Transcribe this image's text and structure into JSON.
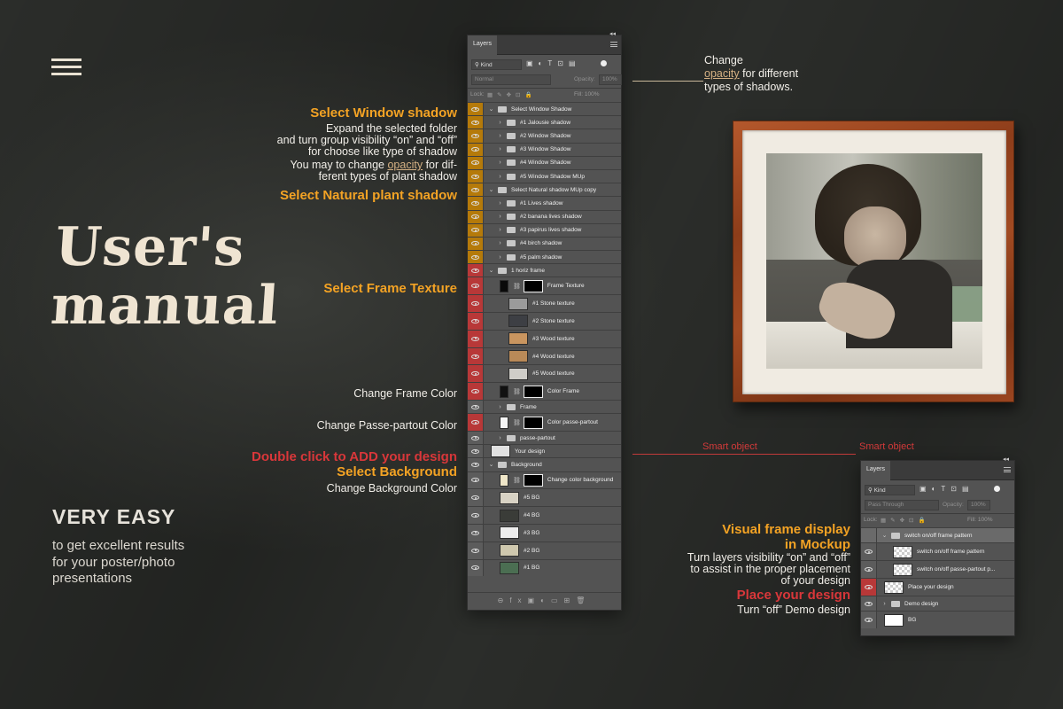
{
  "heading": {
    "title_line1": "User's",
    "title_line2": "manual"
  },
  "easy": {
    "heading": "VERY EASY",
    "line1": "to get excellent results",
    "line2": "for your poster/photo",
    "line3": "presentations"
  },
  "top_note": {
    "line1": "Change",
    "line2_highlight": "opacity",
    "line2_rest": " for different",
    "line3": "types of shadows."
  },
  "smart_object": {
    "label_left": "Smart object",
    "label_right": "Smart object"
  },
  "annotations": {
    "select_window_shadow": "Select Window shadow",
    "expand_line1": "Expand the selected folder",
    "expand_line2": "and turn group visibility “on” and “off”",
    "expand_line3": "for choose like type of shadow",
    "change_op_pre": "You may to change ",
    "change_op_link": "opacity",
    "change_op_post": " for dif-",
    "change_op_line2": "ferent types of plant shadow",
    "select_natural": "Select Natural plant shadow",
    "select_frame_texture": "Select Frame Texture",
    "change_frame_color": "Change Frame Color",
    "change_passe_color": "Change Passe-partout Color",
    "double_click": "Double click to ADD your design",
    "select_background": "Select Background",
    "change_background": "Change Background Color"
  },
  "right_annotations": {
    "visual_line1": "Visual frame display",
    "visual_line2": "in Mockup",
    "turn_line1": "Turn layers visibility “on” and “off”",
    "turn_line2": "to assist in the proper placement",
    "turn_line3": "of your design",
    "place_design": "Place your design",
    "turn_off_demo": "Turn “off” Demo design"
  },
  "panel_main": {
    "tab": "Layers",
    "kind": "⚲ Kind",
    "blend": "Normal",
    "opacity_label": "Opacity:",
    "opacity_value": "100%",
    "lock_label": "Lock:",
    "fill_label": "Fill:",
    "fill_value": "100%",
    "layers": [
      {
        "name": "Select Window Shadow",
        "kind": "group",
        "indent": 0,
        "vis": "or",
        "open": true
      },
      {
        "name": "#1 Jalousie shadow",
        "kind": "group",
        "indent": 1,
        "vis": "or"
      },
      {
        "name": "#2 Window Shadow",
        "kind": "group",
        "indent": 1,
        "vis": "or"
      },
      {
        "name": "#3 Window Shadow",
        "kind": "group",
        "indent": 1,
        "vis": "or"
      },
      {
        "name": "#4 Window Shadow",
        "kind": "group",
        "indent": 1,
        "vis": "or"
      },
      {
        "name": "#5 Window Shadow MUp",
        "kind": "group",
        "indent": 1,
        "vis": "or"
      },
      {
        "name": "Select Natural shadow MUp copy",
        "kind": "group",
        "indent": 0,
        "vis": "or",
        "open": true
      },
      {
        "name": "#1 Lives shadow",
        "kind": "group",
        "indent": 1,
        "vis": "or"
      },
      {
        "name": "#2 banana lives shadow",
        "kind": "group",
        "indent": 1,
        "vis": "or"
      },
      {
        "name": "#3 papirus lives shadow",
        "kind": "group",
        "indent": 1,
        "vis": "or"
      },
      {
        "name": "#4 birch shadow",
        "kind": "group",
        "indent": 1,
        "vis": "or"
      },
      {
        "name": "#5 palm shadow",
        "kind": "group",
        "indent": 1,
        "vis": "or"
      },
      {
        "name": "1 horiz frame",
        "kind": "group",
        "indent": 0,
        "vis": "red",
        "open": true
      },
      {
        "name": "Frame Texture",
        "kind": "smart",
        "indent": 1,
        "vis": "red",
        "thumb": "#0a0a0a",
        "tall": true
      },
      {
        "name": "#1 Stone texture",
        "kind": "image",
        "indent": 2,
        "vis": "red",
        "thumb": "#9a9a9a",
        "tall": true
      },
      {
        "name": "#2 Stone texture",
        "kind": "image",
        "indent": 2,
        "vis": "red",
        "thumb": "#3d3f44",
        "tall": true
      },
      {
        "name": "#3 Wood texture",
        "kind": "image",
        "indent": 2,
        "vis": "red",
        "thumb": "#c9955f",
        "tall": true
      },
      {
        "name": "#4 Wood texture",
        "kind": "image",
        "indent": 2,
        "vis": "red",
        "thumb": "#b98a58",
        "tall": true
      },
      {
        "name": "#5 Wood texture",
        "kind": "image",
        "indent": 2,
        "vis": "red",
        "thumb": "#cfcdc8",
        "tall": true
      },
      {
        "name": "Color Frame",
        "kind": "fill",
        "indent": 1,
        "vis": "red",
        "thumb": "#111111",
        "tall": true
      },
      {
        "name": "Frame",
        "kind": "group",
        "indent": 1,
        "vis": "grey"
      },
      {
        "name": "Color passe-partout",
        "kind": "fill",
        "indent": 1,
        "vis": "red",
        "thumb": "#f5f5f5",
        "tall": true
      },
      {
        "name": "passe-partout",
        "kind": "group",
        "indent": 1,
        "vis": "grey"
      },
      {
        "name": "Your design",
        "kind": "image",
        "indent": 0,
        "vis": "grey",
        "thumb": "#e0e0e0"
      },
      {
        "name": "Background",
        "kind": "group",
        "indent": 0,
        "vis": "grey",
        "open": true
      },
      {
        "name": "Change color background",
        "kind": "fill",
        "indent": 1,
        "vis": "grey",
        "thumb": "#efe6c8",
        "tall": true
      },
      {
        "name": "#5 BG",
        "kind": "image",
        "indent": 1,
        "vis": "grey",
        "thumb": "#d8d2c4",
        "tall": true
      },
      {
        "name": "#4 BG",
        "kind": "image",
        "indent": 1,
        "vis": "grey",
        "thumb": "#3a3c38",
        "tall": true
      },
      {
        "name": "#3 BG",
        "kind": "image",
        "indent": 1,
        "vis": "grey",
        "thumb": "#ededed",
        "tall": true
      },
      {
        "name": "#2 BG",
        "kind": "image",
        "indent": 1,
        "vis": "grey",
        "thumb": "#cfc8ae",
        "tall": true
      },
      {
        "name": "#1 BG",
        "kind": "image",
        "indent": 1,
        "vis": "grey",
        "thumb": "#4b6e52",
        "tall": true
      }
    ]
  },
  "panel_small": {
    "tab": "Layers",
    "kind": "⚲ Kind",
    "blend": "Pass Through",
    "opacity_label": "Opacity:",
    "opacity_value": "100%",
    "lock_label": "Lock:",
    "fill_label": "Fill:",
    "fill_value": "100%",
    "layers": [
      {
        "name": "switch on/off frame pattern",
        "kind": "group",
        "indent": 0,
        "vis": "none",
        "open": true
      },
      {
        "name": "switch on/off frame pattern",
        "kind": "image",
        "indent": 1,
        "vis": "grey",
        "thumb": "checker",
        "tall": true
      },
      {
        "name": "switch on/off passe-partout p...",
        "kind": "image",
        "indent": 1,
        "vis": "grey",
        "thumb": "checker",
        "tall": true
      },
      {
        "name": "Place your design",
        "kind": "image",
        "indent": 0,
        "vis": "red",
        "thumb": "checker",
        "tall": true
      },
      {
        "name": "Demo design",
        "kind": "group",
        "indent": 0,
        "vis": "grey"
      },
      {
        "name": "BG",
        "kind": "image",
        "indent": 0,
        "vis": "grey",
        "thumb": "#ffffff",
        "tall": true
      }
    ]
  },
  "colors": {
    "orange": "#f4a324",
    "red": "#d9373a",
    "background": "#2b2d2a",
    "panel": "#535353"
  }
}
